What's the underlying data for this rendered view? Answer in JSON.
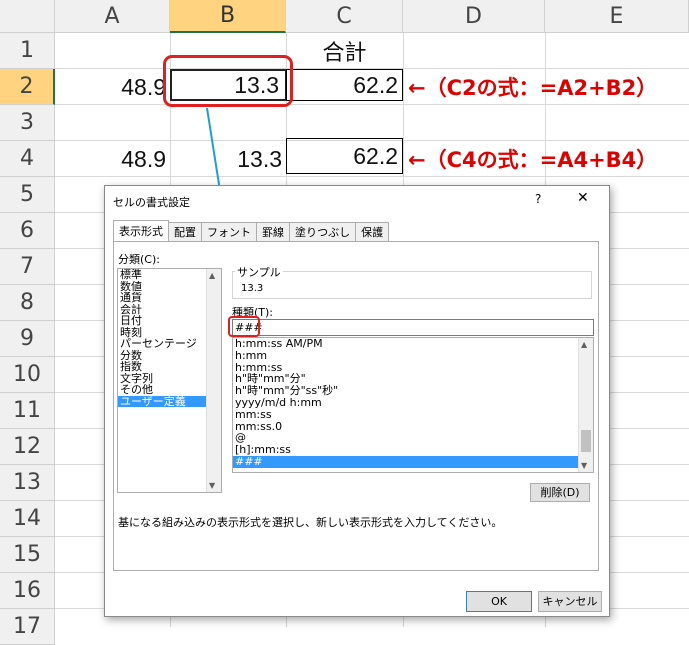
{
  "sheet": {
    "columns": [
      "A",
      "B",
      "C",
      "D",
      "E"
    ],
    "rows": [
      "1",
      "2",
      "3",
      "4",
      "5",
      "6",
      "7",
      "8",
      "9",
      "10",
      "11",
      "12",
      "13",
      "14",
      "15",
      "16",
      "17"
    ],
    "cells": {
      "C1": "合計",
      "A2": "48.9",
      "B2": "13.3",
      "C2": "62.2",
      "A4": "48.9",
      "B4": "13.3",
      "C4": "62.2"
    },
    "notes": {
      "row2": "←（C2の式：=A2+B2）",
      "row4": "←（C4の式：=A4+B4）"
    },
    "colors": {
      "annotation": "#e00000",
      "selected_header": "#ffd37f",
      "link_line": "#1aa0d8"
    }
  },
  "dialog": {
    "title": "セルの書式設定",
    "help": "?",
    "close": "✕",
    "tabs": [
      "表示形式",
      "配置",
      "フォント",
      "罫線",
      "塗りつぶし",
      "保護"
    ],
    "category_label": "分類(C):",
    "categories": [
      "標準",
      "数値",
      "通貨",
      "会計",
      "日付",
      "時刻",
      "パーセンテージ",
      "分数",
      "指数",
      "文字列",
      "その他",
      "ユーザー定義"
    ],
    "sample_label": "サンプル",
    "sample_value": "13.3",
    "type_label": "種類(T):",
    "type_value": "###",
    "formats": [
      "h:mm:ss AM/PM",
      "h:mm",
      "h:mm:ss",
      "h\"時\"mm\"分\"",
      "h\"時\"mm\"分\"ss\"秒\"",
      "yyyy/m/d h:mm",
      "mm:ss",
      "mm:ss.0",
      "@",
      "[h]:mm:ss",
      "###"
    ],
    "delete_button": "削除(D)",
    "description": "基になる組み込みの表示形式を選択し、新しい表示形式を入力してください。",
    "ok_button": "OK",
    "cancel_button": "キャンセル"
  }
}
